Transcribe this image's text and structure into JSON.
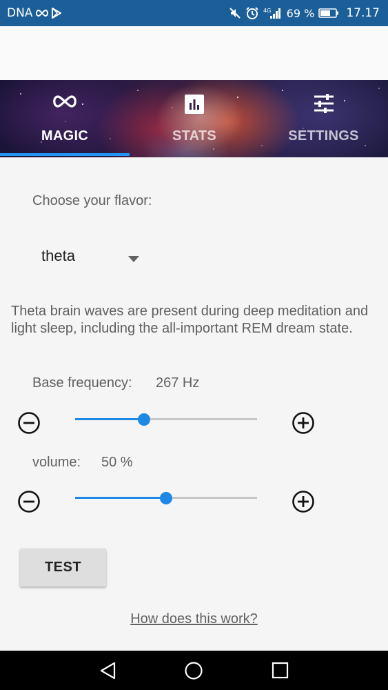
{
  "status_bar": {
    "carrier": "DNA",
    "battery_percent": "69 %",
    "time": "17.17",
    "network_type": "4G",
    "icons": [
      "infinity-icon",
      "play-store-icon",
      "mute-icon",
      "alarm-icon",
      "signal-icon",
      "battery-icon"
    ],
    "background_color": "#1c5e98"
  },
  "tabs": [
    {
      "label": "MAGIC",
      "icon": "infinity-icon",
      "active": true
    },
    {
      "label": "STATS",
      "icon": "bar-chart-icon",
      "active": false
    },
    {
      "label": "SETTINGS",
      "icon": "sliders-icon",
      "active": false
    }
  ],
  "flavor": {
    "prompt": "Choose your flavor:",
    "selected": "theta",
    "description": "Theta brain waves are present during deep meditation and light sleep, including the all-important REM dream state."
  },
  "base_frequency": {
    "label": "Base frequency:",
    "value_text": "267 Hz",
    "slider_fraction": 0.38
  },
  "volume": {
    "label": "volume:",
    "value_text": "50 %",
    "slider_fraction": 0.5
  },
  "controls": {
    "minus_icon": "minus-circle-icon",
    "plus_icon": "plus-circle-icon"
  },
  "test_button": {
    "label": "TEST"
  },
  "help_link": {
    "label": "How does this work?"
  },
  "nav_bar": {
    "buttons": [
      "back-icon",
      "home-icon",
      "recents-icon"
    ]
  },
  "colors": {
    "accent": "#1e88e5",
    "tab_indicator": "#2196f3",
    "nav_bar": "#000000"
  }
}
